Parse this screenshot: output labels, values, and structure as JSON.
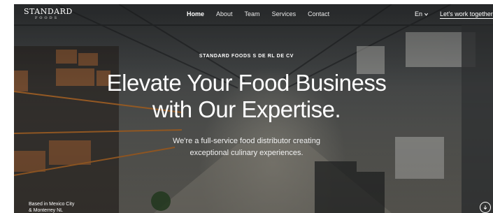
{
  "brand": {
    "name": "STANDARD",
    "sub": "FOODS"
  },
  "nav": {
    "items": [
      {
        "label": "Home",
        "active": true
      },
      {
        "label": "About",
        "active": false
      },
      {
        "label": "Team",
        "active": false
      },
      {
        "label": "Services",
        "active": false
      },
      {
        "label": "Contact",
        "active": false
      }
    ],
    "language": "En",
    "cta": "Let's work together"
  },
  "hero": {
    "eyebrow": "STANDARD FOODS S DE RL DE CV",
    "headline_line1": "Elevate Your Food Business",
    "headline_line2": "with Our Expertise.",
    "sub_line1": "We're a full-service food distributor creating",
    "sub_line2": "exceptional culinary experiences.",
    "location_line1": "Based in Mexico City",
    "location_line2": "& Monterrey NL"
  },
  "icons": {
    "language_caret": "chevron-down-icon",
    "scroll": "arrow-down-icon"
  },
  "colors": {
    "text": "#ffffff",
    "background": "#4a4d4e"
  }
}
